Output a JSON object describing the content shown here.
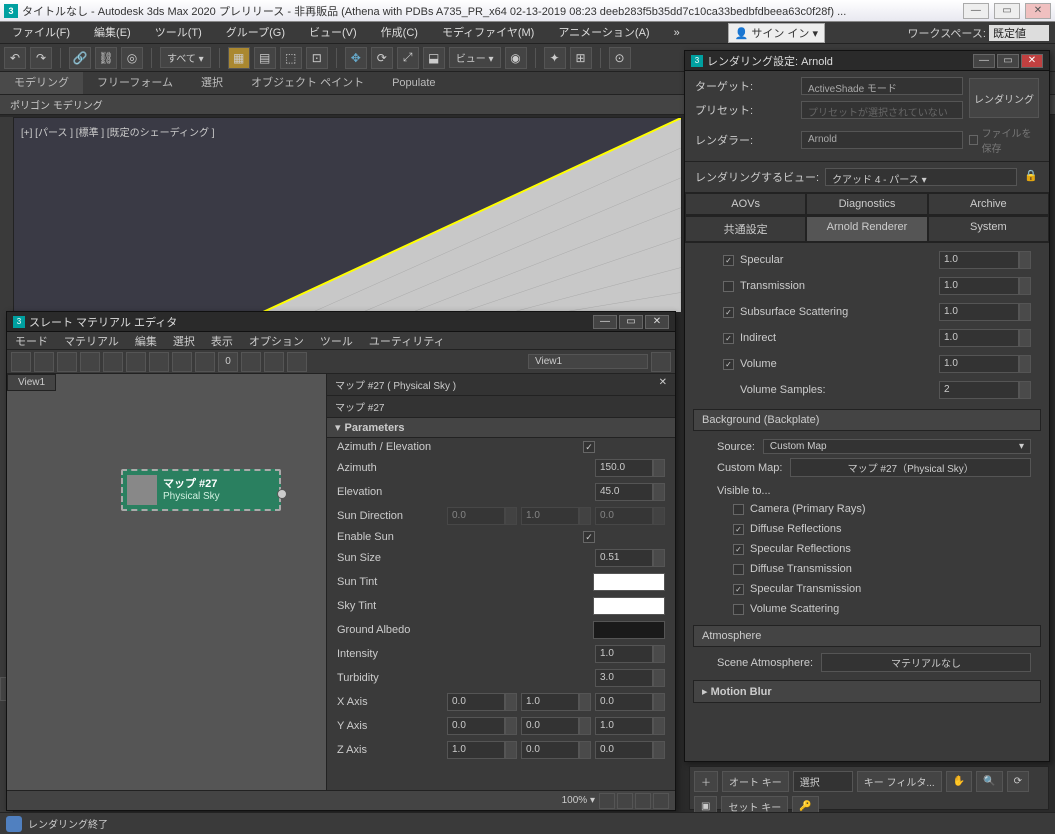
{
  "window": {
    "title": "タイトルなし - Autodesk 3ds Max 2020 プレリリース  - 非再販品 (Athena with PDBs A735_PR_x64 02-13-2019 08:23 deeb283f5b35dd7c10ca33bedbfdbeea63c0f28f) ...",
    "logo": "3"
  },
  "menus": {
    "file": "ファイル(F)",
    "edit": "編集(E)",
    "tools": "ツール(T)",
    "group": "グループ(G)",
    "views": "ビュー(V)",
    "create": "作成(C)",
    "modifiers": "モディファイヤ(M)",
    "animation": "アニメーション(A)",
    "signin": "サイン イン",
    "workspace_lbl": "ワークスペース:",
    "workspace_val": "既定値"
  },
  "toolbar": {
    "all": "すべて",
    "views": "ビュー"
  },
  "ribbon": {
    "modeling": "モデリング",
    "freeform": "フリーフォーム",
    "selection": "選択",
    "objectpaint": "オブジェクト ペイント",
    "populate": "Populate",
    "sub": "ポリゴン モデリング"
  },
  "viewport": {
    "label": "[+] [パース ] [標準 ] [既定のシェーディング ]"
  },
  "slate": {
    "title": "スレート マテリアル エディタ",
    "menu": {
      "modes": "モード",
      "material": "マテリアル",
      "edit": "編集",
      "select": "選択",
      "view": "表示",
      "options": "オプション",
      "tools": "ツール",
      "utilities": "ユーティリティ"
    },
    "viewdd": "View1",
    "viewtab": "View1",
    "node": {
      "name": "マップ #27",
      "type": "Physical Sky"
    },
    "params": {
      "header": "マップ #27  ( Physical Sky )",
      "header2": "マップ #27",
      "section": "Parameters",
      "azimuth_elev": "Azimuth / Elevation",
      "azimuth": "Azimuth",
      "azimuth_v": "150.0",
      "elevation": "Elevation",
      "elevation_v": "45.0",
      "sundir": "Sun Direction",
      "sundir1": "0.0",
      "sundir2": "1.0",
      "sundir3": "0.0",
      "enablesun": "Enable Sun",
      "sunsize": "Sun Size",
      "sunsize_v": "0.51",
      "suntint": "Sun Tint",
      "skytint": "Sky Tint",
      "groundalbedo": "Ground Albedo",
      "intensity": "Intensity",
      "intensity_v": "1.0",
      "turbidity": "Turbidity",
      "turbidity_v": "3.0",
      "xaxis": "X Axis",
      "x1": "0.0",
      "x2": "1.0",
      "x3": "0.0",
      "yaxis": "Y Axis",
      "y1": "0.0",
      "y2": "0.0",
      "y3": "1.0",
      "zaxis": "Z Axis",
      "z1": "1.0",
      "z2": "0.0",
      "z3": "0.0"
    },
    "status_zoom": "100%"
  },
  "render": {
    "title": "レンダリング設定: Arnold",
    "target_lbl": "ターゲット:",
    "target_v": "ActiveShade モード",
    "preset_lbl": "プリセット:",
    "preset_v": "プリセットが選択されていない",
    "renderer_lbl": "レンダラー:",
    "renderer_v": "Arnold",
    "savefile": "ファイルを保存",
    "render_btn": "レンダリング",
    "view_lbl": "レンダリングするビュー:",
    "view_v": "クアッド 4 - パース",
    "tabs": {
      "aovs": "AOVs",
      "diagnostics": "Diagnostics",
      "archive": "Archive",
      "common": "共通設定",
      "arnold": "Arnold Renderer",
      "system": "System"
    },
    "ray": {
      "specular": "Specular",
      "specular_v": "1.0",
      "transmission": "Transmission",
      "transmission_v": "1.0",
      "sss": "Subsurface Scattering",
      "sss_v": "1.0",
      "indirect": "Indirect",
      "indirect_v": "1.0",
      "volume": "Volume",
      "volume_v": "1.0",
      "volsamples": "Volume Samples:",
      "volsamples_v": "2"
    },
    "bg": {
      "title": "Background (Backplate)",
      "source_lbl": "Source:",
      "source_v": "Custom Map",
      "custommap_lbl": "Custom Map:",
      "custommap_v": "マップ #27（Physical Sky）",
      "visible": "Visible to...",
      "camera": "Camera (Primary Rays)",
      "diffrefl": "Diffuse Reflections",
      "specrefl": "Specular Reflections",
      "difftrans": "Diffuse Transmission",
      "spectrans": "Specular Transmission",
      "volscatter": "Volume Scattering"
    },
    "atmo": {
      "title": "Atmosphere",
      "scene_lbl": "Scene Atmosphere:",
      "scene_v": "マテリアルなし"
    },
    "motionblur": "Motion Blur"
  },
  "bottom": {
    "autokey": "オート キー",
    "setkey": "セット キー",
    "sel": "選択",
    "keyfilter": "キー フィルタ..."
  },
  "status": "レンダリング終了"
}
